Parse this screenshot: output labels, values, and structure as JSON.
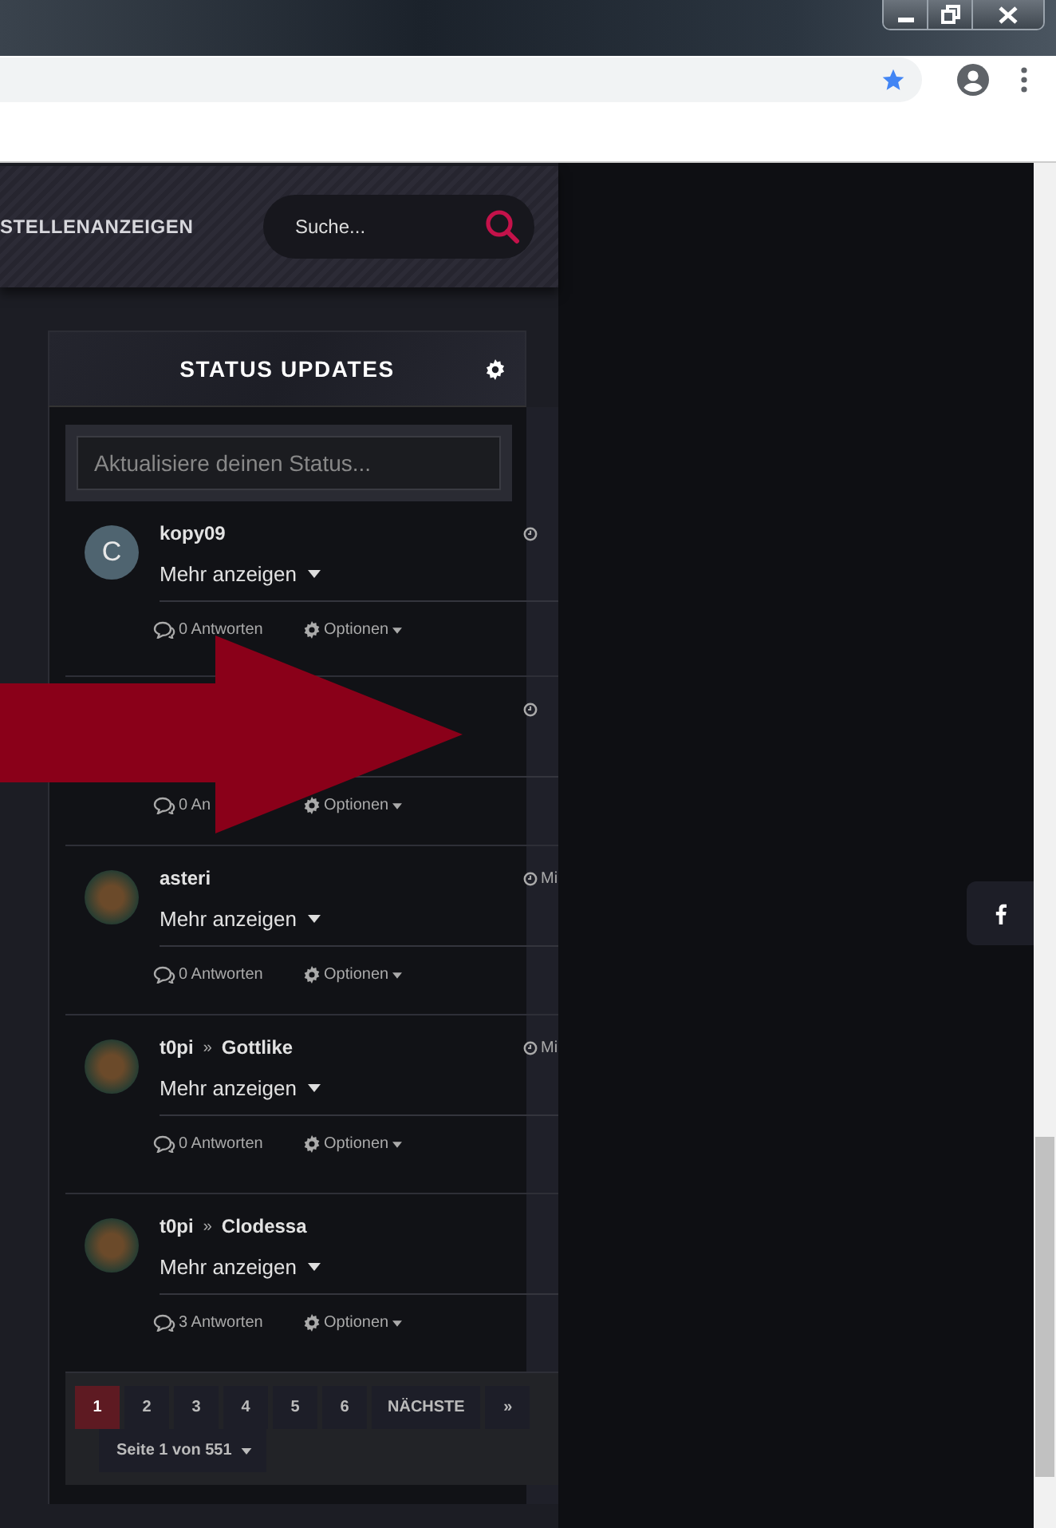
{
  "nav": {
    "item": "STELLENANZEIGEN",
    "search": {
      "placeholder": "Suche..."
    }
  },
  "status_panel": {
    "title": "STATUS UPDATES",
    "status_input": {
      "placeholder": "Aktualisiere deinen Status..."
    },
    "updates": [
      {
        "avatar": {
          "kind": "letter",
          "letter": "C"
        },
        "author": "kopy09",
        "more": "Mehr anzeigen",
        "replies": "0 Antworten",
        "options": "Optionen",
        "clock": true
      },
      {
        "avatar": {
          "kind": "hidden"
        },
        "replies": "0 An",
        "options": "Optionen",
        "clock": true
      },
      {
        "avatar": {
          "kind": "photo"
        },
        "author": "asteri",
        "more": "Mehr anzeigen",
        "replies": "0 Antworten",
        "options": "Optionen",
        "clock": true,
        "time": "Mi"
      },
      {
        "avatar": {
          "kind": "photo"
        },
        "author": "t0pi",
        "separator": "»",
        "recipient": "Gottlike",
        "more": "Mehr anzeigen",
        "replies": "0 Antworten",
        "options": "Optionen",
        "clock": true,
        "time": "Mi"
      },
      {
        "avatar": {
          "kind": "photo"
        },
        "author": "t0pi",
        "separator": "»",
        "recipient": "Clodessa",
        "more": "Mehr anzeigen",
        "replies": "3 Antworten",
        "options": "Optionen",
        "clock": false
      }
    ],
    "pagination": {
      "pages": [
        {
          "label": "1",
          "selected": true
        },
        {
          "label": "2",
          "selected": false
        },
        {
          "label": "3",
          "selected": false
        },
        {
          "label": "4",
          "selected": false
        },
        {
          "label": "5",
          "selected": false
        },
        {
          "label": "6",
          "selected": false
        }
      ],
      "next": "NÄCHSTE",
      "last": "»",
      "page_info": "Seite 1 von 551"
    }
  },
  "annotation": {
    "kind": "arrow"
  }
}
